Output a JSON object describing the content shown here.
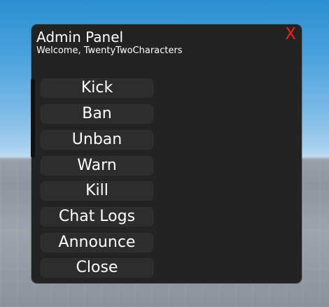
{
  "panel": {
    "title": "Admin Panel",
    "subtitle": "Welcome, TwentyTwoCharacters",
    "close_glyph": "X",
    "colors": {
      "panel_bg": "#232323",
      "button_bg": "#2d2d2d",
      "close_color": "#ff1a1a",
      "text": "#ffffff"
    },
    "buttons": [
      {
        "label": "Kick"
      },
      {
        "label": "Ban"
      },
      {
        "label": "Unban"
      },
      {
        "label": "Warn"
      },
      {
        "label": "Kill"
      },
      {
        "label": "Chat Logs"
      },
      {
        "label": "Announce"
      },
      {
        "label": "Close"
      }
    ]
  }
}
